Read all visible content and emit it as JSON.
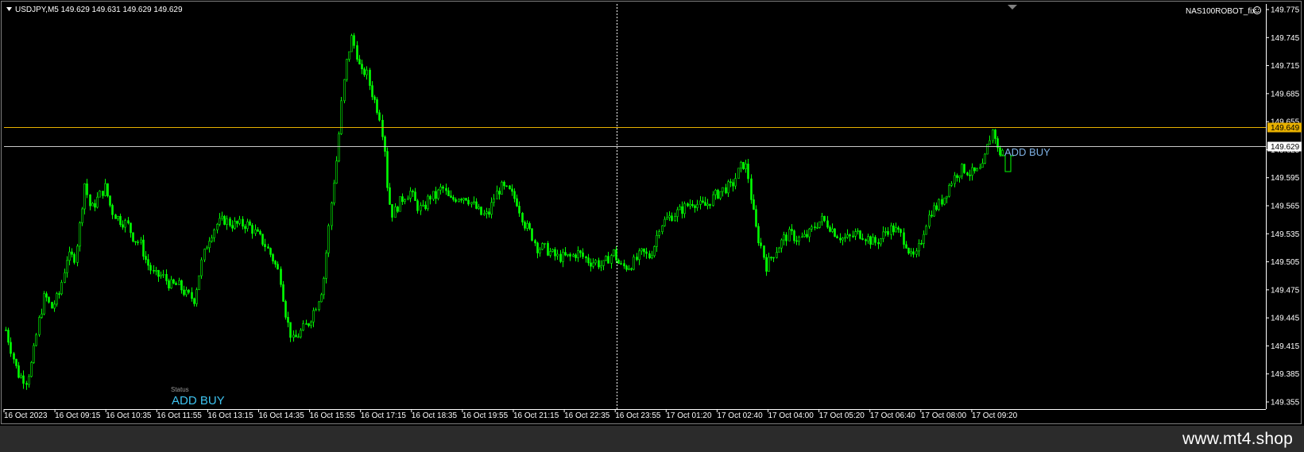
{
  "header": {
    "symbol_info": "USDJPY,M5  149.629 149.631 149.629 149.629",
    "expert_name": "NAS100ROBOT_fix"
  },
  "status_panel": {
    "label": "Status",
    "value": "ADD BUY"
  },
  "chart_annotation": "ADD BUY",
  "price_axis": {
    "labels": [
      "149.775",
      "149.745",
      "149.715",
      "149.685",
      "149.655",
      "149.625",
      "149.595",
      "149.565",
      "149.535",
      "149.505",
      "149.475",
      "149.445",
      "149.415",
      "149.385",
      "149.355"
    ],
    "ask_line": {
      "label": "149.649",
      "color": "#e8b100"
    },
    "bid_line": {
      "label": "149.629",
      "color": "#ffffff"
    }
  },
  "time_axis": {
    "labels": [
      "16 Oct 2023",
      "16 Oct 09:15",
      "16 Oct 10:35",
      "16 Oct 11:55",
      "16 Oct 13:15",
      "16 Oct 14:35",
      "16 Oct 15:55",
      "16 Oct 17:15",
      "16 Oct 18:35",
      "16 Oct 19:55",
      "16 Oct 21:15",
      "16 Oct 22:35",
      "16 Oct 23:55",
      "17 Oct 01:20",
      "17 Oct 02:40",
      "17 Oct 04:00",
      "17 Oct 05:20",
      "17 Oct 06:40",
      "17 Oct 08:00",
      "17 Oct 09:20"
    ]
  },
  "colors": {
    "background": "#000000",
    "candle": "#00ff00",
    "grid_text": "#ffffff",
    "annotation": "#7fb2e5",
    "status_value": "#3ec3f0",
    "footer_bg": "#2b2b2b"
  },
  "chart_data": {
    "type": "candlestick",
    "symbol": "USDJPY",
    "timeframe": "M5",
    "ylim": [
      149.355,
      149.775
    ],
    "x_range": [
      "16 Oct 2023",
      "17 Oct 09:50"
    ],
    "key_levels": {
      "start": 149.43,
      "low_1": 149.38,
      "swing_high_1": 149.6,
      "peak": 149.755,
      "mid_range": [
        149.49,
        149.6
      ],
      "end": 149.629
    }
  },
  "footer": {
    "watermark": "www.mt4.shop"
  }
}
